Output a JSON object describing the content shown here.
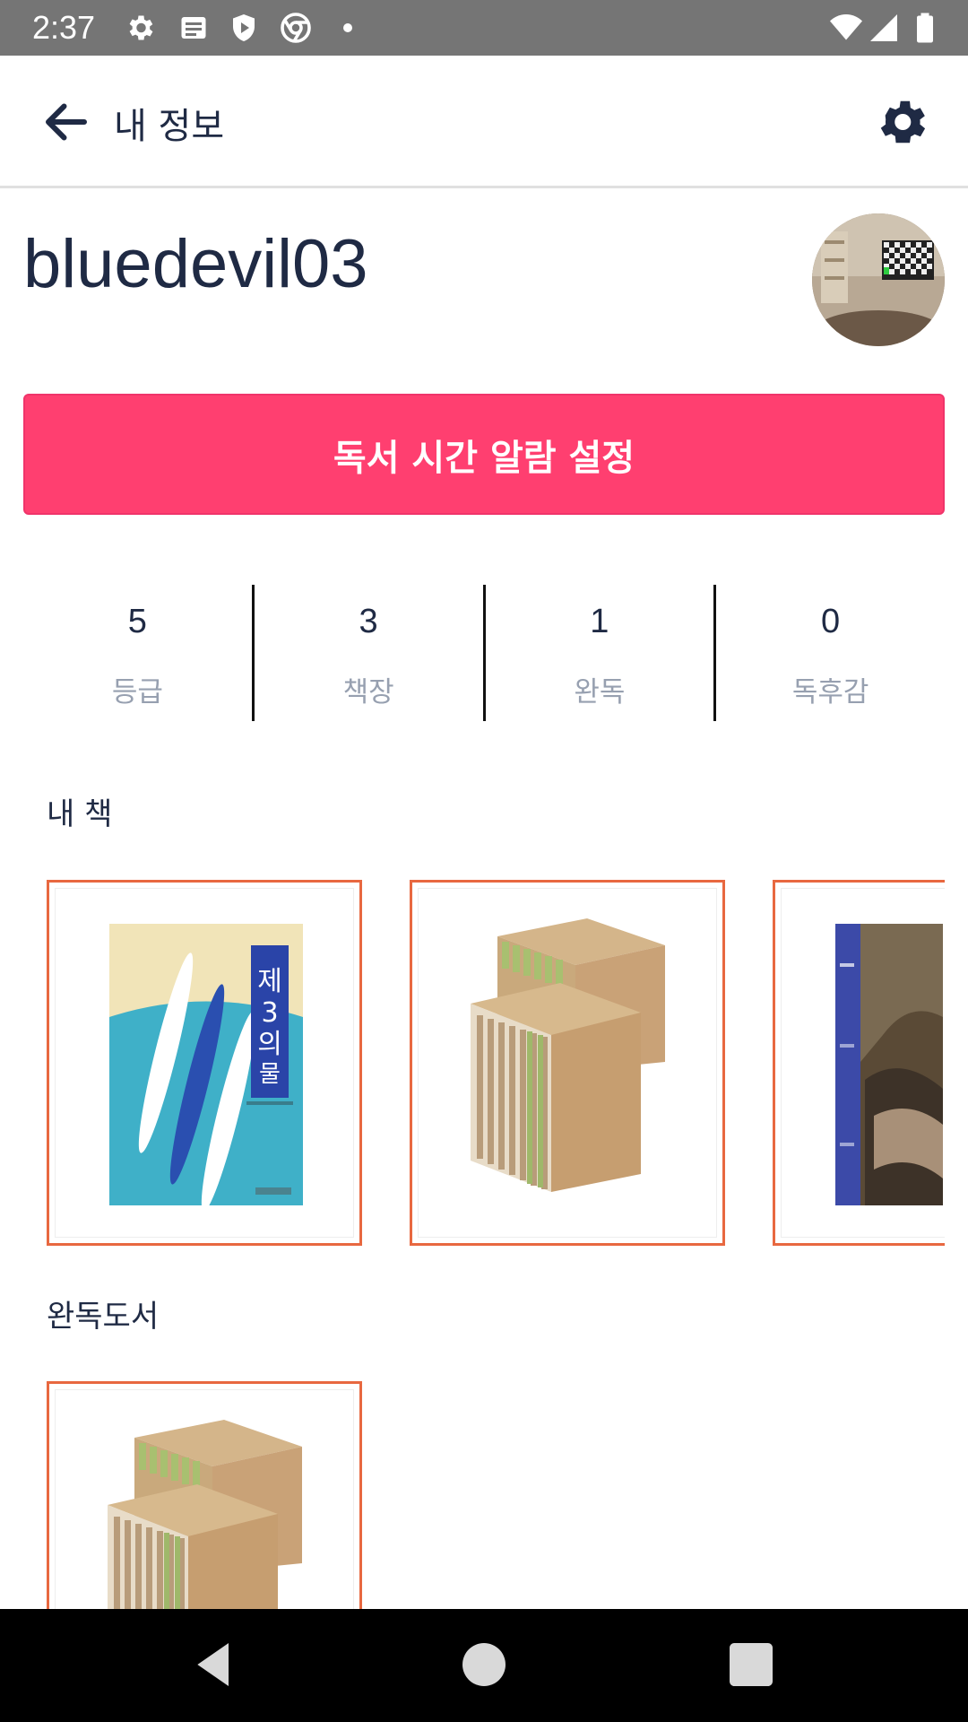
{
  "status_bar": {
    "time": "2:37"
  },
  "app_bar": {
    "title": "내 정보"
  },
  "profile": {
    "username": "bluedevil03"
  },
  "alarm_button": {
    "label": "독서 시간 알람 설정",
    "color": "#ff3f70"
  },
  "stats": [
    {
      "value": "5",
      "label": "등급"
    },
    {
      "value": "3",
      "label": "책장"
    },
    {
      "value": "1",
      "label": "완독"
    },
    {
      "value": "0",
      "label": "독후감"
    }
  ],
  "my_books": {
    "title": "내 책",
    "cover_texts": {
      "book1_title": "제3의물결"
    }
  },
  "finished_books": {
    "title": "완독도서"
  },
  "colors": {
    "accent": "#ff3f70",
    "card_border": "#e86840",
    "text_primary": "#1f2a44",
    "text_secondary": "#97a0b0"
  },
  "icons": [
    "settings-icon",
    "notes-icon",
    "shield-icon",
    "chrome-icon",
    "wifi-icon",
    "signal-icon",
    "battery-icon",
    "back-arrow-icon",
    "gear-icon",
    "nav-back-icon",
    "nav-home-icon",
    "nav-recents-icon"
  ]
}
